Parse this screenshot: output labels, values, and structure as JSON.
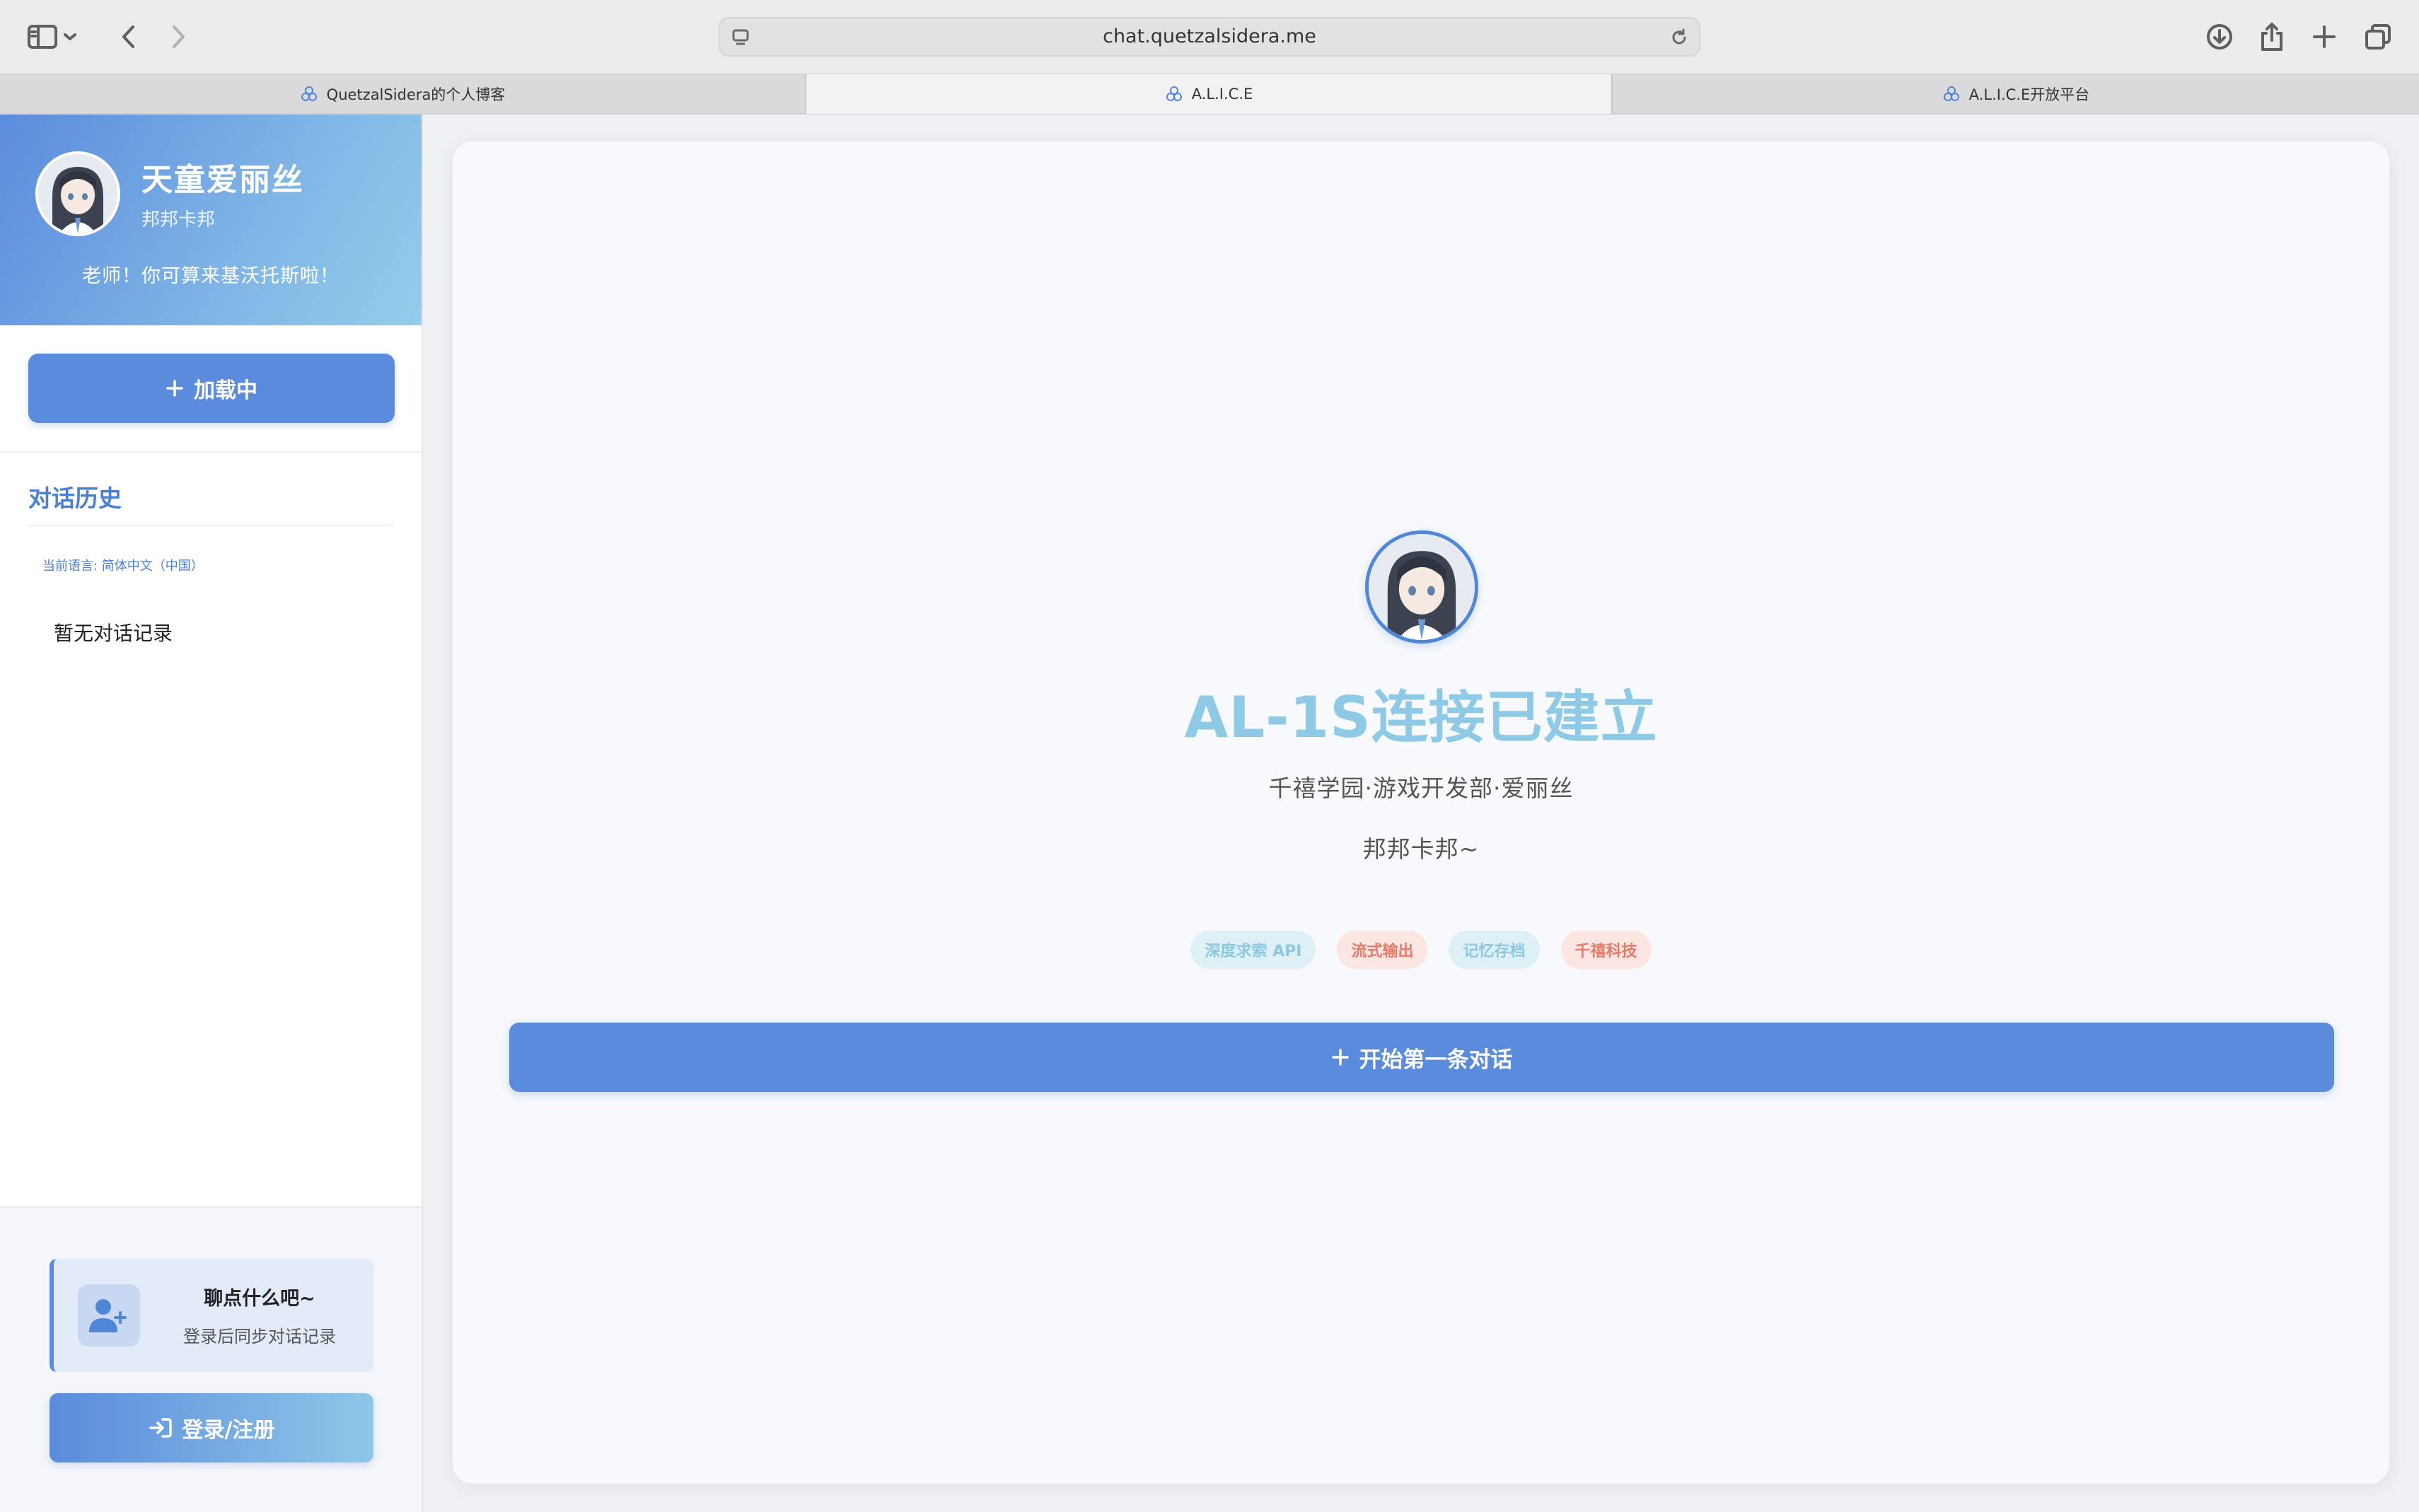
{
  "browser": {
    "url": "chat.quetzalsidera.me",
    "tabs": [
      {
        "label": "QuetzalSidera的个人博客",
        "active": false
      },
      {
        "label": "A.L.I.C.E",
        "active": true
      },
      {
        "label": "A.L.I.C.E开放平台",
        "active": false
      }
    ]
  },
  "sidebar": {
    "profile": {
      "name": "天童爱丽丝",
      "subtitle": "邦邦卡邦",
      "quote": "老师！你可算来基沃托斯啦！"
    },
    "new_button_label": "加载中",
    "history_title": "对话历史",
    "language_note": "当前语言: 简体中文（中国）",
    "empty_history": "暂无对话记录",
    "chat_card": {
      "title": "聊点什么吧~",
      "subtitle": "登录后同步对话记录"
    },
    "login_button_label": "登录/注册"
  },
  "main": {
    "title": "AL-1S连接已建立",
    "subtitle": "千禧学园·游戏开发部·爱丽丝",
    "subtitle2": "邦邦卡邦~",
    "tags": [
      {
        "label": "深度求索 API",
        "color": "blue"
      },
      {
        "label": "流式输出",
        "color": "orange"
      },
      {
        "label": "记忆存档",
        "color": "blue"
      },
      {
        "label": "千禧科技",
        "color": "orange"
      }
    ],
    "start_button_label": "开始第一条对话"
  },
  "colors": {
    "accent": "#5b8bdc",
    "title": "#8ec9e6",
    "tag_blue_bg": "#dcf0f6",
    "tag_orange_bg": "#fde5e2"
  },
  "icons": {
    "toolbar": [
      "sidebar-toggle-icon",
      "chevron-down-icon",
      "back-icon",
      "forward-icon",
      "download-icon",
      "share-icon",
      "new-tab-icon",
      "tab-overview-icon"
    ],
    "tab_favicon": "alice-logo-icon",
    "new_chat": "plus-icon",
    "login": "sign-in-icon",
    "chat_card": "user-plus-icon"
  }
}
